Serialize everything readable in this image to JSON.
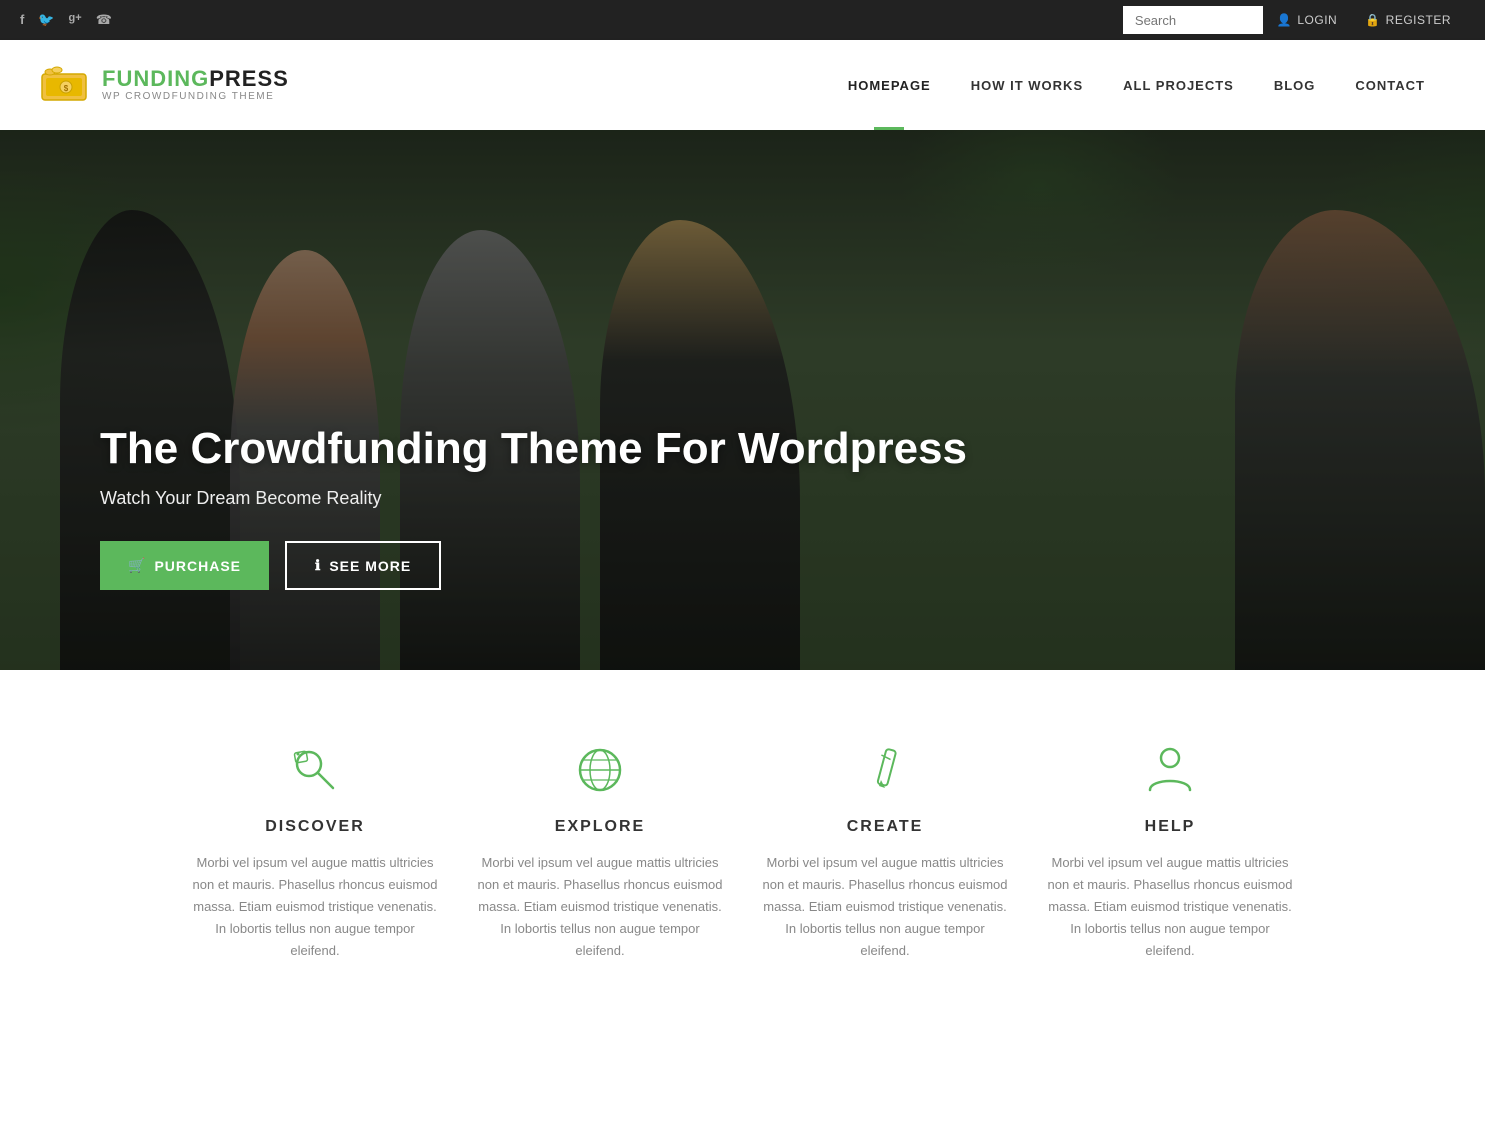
{
  "topbar": {
    "social": [
      {
        "name": "facebook",
        "icon": "f"
      },
      {
        "name": "twitter",
        "icon": "𝕏"
      },
      {
        "name": "google-plus",
        "icon": "g+"
      },
      {
        "name": "skype",
        "icon": "s"
      }
    ],
    "search_placeholder": "Search",
    "login_label": "LOGIN",
    "register_label": "REGISTER"
  },
  "navbar": {
    "logo_funding": "FUNDING",
    "logo_press": "PRESS",
    "logo_sub": "WP CROWDFUNDING THEME",
    "nav_items": [
      {
        "label": "HOMEPAGE",
        "active": true
      },
      {
        "label": "HOW IT WORKS",
        "active": false
      },
      {
        "label": "ALL PROJECTS",
        "active": false
      },
      {
        "label": "BLOG",
        "active": false
      },
      {
        "label": "CONTACT",
        "active": false
      }
    ]
  },
  "hero": {
    "title": "The Crowdfunding Theme For Wordpress",
    "subtitle": "Watch Your Dream Become Reality",
    "btn_purchase": "PURCHASE",
    "btn_seemore": "SEE MORE"
  },
  "features": {
    "items": [
      {
        "icon": "tag-icon",
        "title": "DISCOVER",
        "desc": "Morbi vel ipsum vel augue mattis ultricies non et mauris. Phasellus rhoncus euismod massa. Etiam euismod tristique venenatis. In lobortis tellus non augue tempor eleifend."
      },
      {
        "icon": "globe-icon",
        "title": "EXPLORE",
        "desc": "Morbi vel ipsum vel augue mattis ultricies non et mauris. Phasellus rhoncus euismod massa. Etiam euismod tristique venenatis. In lobortis tellus non augue tempor eleifend."
      },
      {
        "icon": "pencil-icon",
        "title": "CREATE",
        "desc": "Morbi vel ipsum vel augue mattis ultricies non et mauris. Phasellus rhoncus euismod massa. Etiam euismod tristique venenatis. In lobortis tellus non augue tempor eleifend."
      },
      {
        "icon": "person-icon",
        "title": "HELP",
        "desc": "Morbi vel ipsum vel augue mattis ultricies non et mauris. Phasellus rhoncus euismod massa. Etiam euismod tristique venenatis. In lobortis tellus non augue tempor eleifend."
      }
    ]
  },
  "colors": {
    "green": "#5cb85c",
    "dark": "#222222",
    "topbar": "#222222"
  }
}
